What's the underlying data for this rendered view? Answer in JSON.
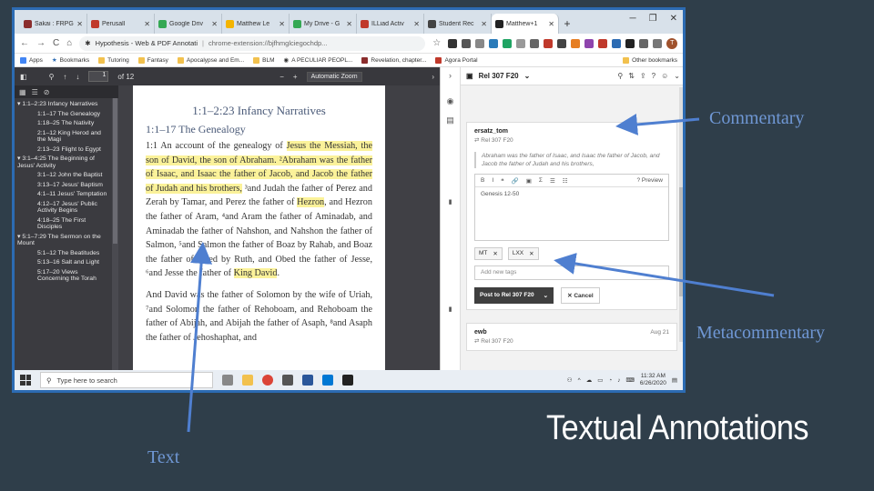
{
  "browser": {
    "tabs": [
      {
        "label": "Sakai : FRPG",
        "color": "#8b2d2d"
      },
      {
        "label": "Perusall",
        "color": "#c0392b"
      },
      {
        "label": "Google Driv",
        "color": "#34a853"
      },
      {
        "label": "Matthew Le",
        "color": "#f4b400"
      },
      {
        "label": "My Drive - G",
        "color": "#34a853"
      },
      {
        "label": "ILLiad Activ",
        "color": "#c0392b"
      },
      {
        "label": "Student Rec",
        "color": "#444444"
      },
      {
        "label": "Matthew+1",
        "color": "#222222",
        "active": true
      }
    ],
    "omnibox_title": "Hypothesis - Web & PDF Annotati",
    "omnibox_url": "chrome-extension://bjfhmglciegochdp...",
    "bookmarks": [
      "Apps",
      "Bookmarks",
      "Tutoring",
      "Fantasy",
      "Apocalypse and Em...",
      "BLM",
      "A PECULIAR PEOPL...",
      "Revelation, chapter...",
      "Agora Portal"
    ],
    "other_bookmarks": "Other bookmarks",
    "avatar_letter": "T"
  },
  "pdf": {
    "page_number": "1",
    "page_count": "of 12",
    "zoom": "Automatic Zoom",
    "outline": [
      {
        "label": "1:1–2:23 Infancy Narratives",
        "level": "top"
      },
      {
        "label": "1:1–17 The Genealogy",
        "level": "sub"
      },
      {
        "label": "1:18–25 The Nativity",
        "level": "sub"
      },
      {
        "label": "2:1–12 King Herod and the Magi",
        "level": "sub"
      },
      {
        "label": "2:13–23 Flight to Egypt",
        "level": "sub"
      },
      {
        "label": "3:1–4:25 The Beginning of Jesus' Activity",
        "level": "top"
      },
      {
        "label": "3:1–12 John the Baptist",
        "level": "sub"
      },
      {
        "label": "3:13–17 Jesus' Baptism",
        "level": "sub"
      },
      {
        "label": "4:1–11 Jesus' Temptation",
        "level": "sub"
      },
      {
        "label": "4:12–17 Jesus' Public Activity Begins",
        "level": "sub"
      },
      {
        "label": "4:18–25 The First Disciples",
        "level": "sub"
      },
      {
        "label": "5:1–7:29 The Sermon on the Mount",
        "level": "top"
      },
      {
        "label": "5:1–12 The Beatitudes",
        "level": "sub"
      },
      {
        "label": "5:13–16 Salt and Light",
        "level": "sub"
      },
      {
        "label": "5:17–20 Views Concerning the Torah",
        "level": "sub"
      }
    ],
    "heading": "1:1–2:23 Infancy Narratives",
    "subheading": "1:1–17 The Genealogy",
    "para1_a": "1:1 An account of the genealogy of ",
    "para1_hl1": "Jesus the Messiah, the son of David, the son of Abraham. ²Abraham was the father of Isaac, and Isaac the father of Jacob, and Jacob the father of Judah and his brothers,",
    "para1_b": " ³and Judah the father of Perez and Zerah by Tamar, and Perez the father of ",
    "para1_hl2": "Hezron",
    "para1_c": ", and Hezron the father of Aram, ⁴and Aram the father of Aminadab, and Aminadab the father of Nahshon, and Nahshon the father of Salmon, ⁵and Salmon the father of Boaz by Rahab, and Boaz the father of Obed by Ruth, and Obed the father of Jesse, ⁶and Jesse the father of ",
    "para1_hl3": "King David",
    "para1_d": ".",
    "para2": "And David was the father of Solomon by the wife of Uriah, ⁷and Solomon the father of Rehoboam, and Rehoboam the father of Abijah, and Abijah the father of Asaph, ⁸and Asaph the father of Jehoshaphat, and"
  },
  "hypothesis": {
    "group_name": "Rel 307 F20",
    "annotation": {
      "user": "ersatz_tom",
      "group": "Rel 307 F20",
      "quote": "Abraham was the father of Isaac, and Isaac the father of Jacob, and Jacob the father of Judah and his brothers,",
      "editor_toolbar": [
        "B",
        "I",
        "❝",
        "🔗",
        "▣",
        "Σ",
        "☰",
        "☷"
      ],
      "preview_label": "Preview",
      "body_text": "Genesis 12-50",
      "tags": [
        "MT",
        "LXX"
      ],
      "tag_placeholder": "Add new tags",
      "post_label": "Post to Rel 307 F20",
      "cancel_label": "Cancel"
    },
    "second": {
      "user": "ewb",
      "group": "Rel 307 F20",
      "date": "Aug 21"
    }
  },
  "taskbar": {
    "search_placeholder": "Type here to search",
    "time": "11:32 AM",
    "date": "6/26/2020"
  },
  "slide": {
    "commentary": "Commentary",
    "metacommentary": "Metacommentary",
    "text": "Text",
    "title": "Textual Annotations"
  }
}
